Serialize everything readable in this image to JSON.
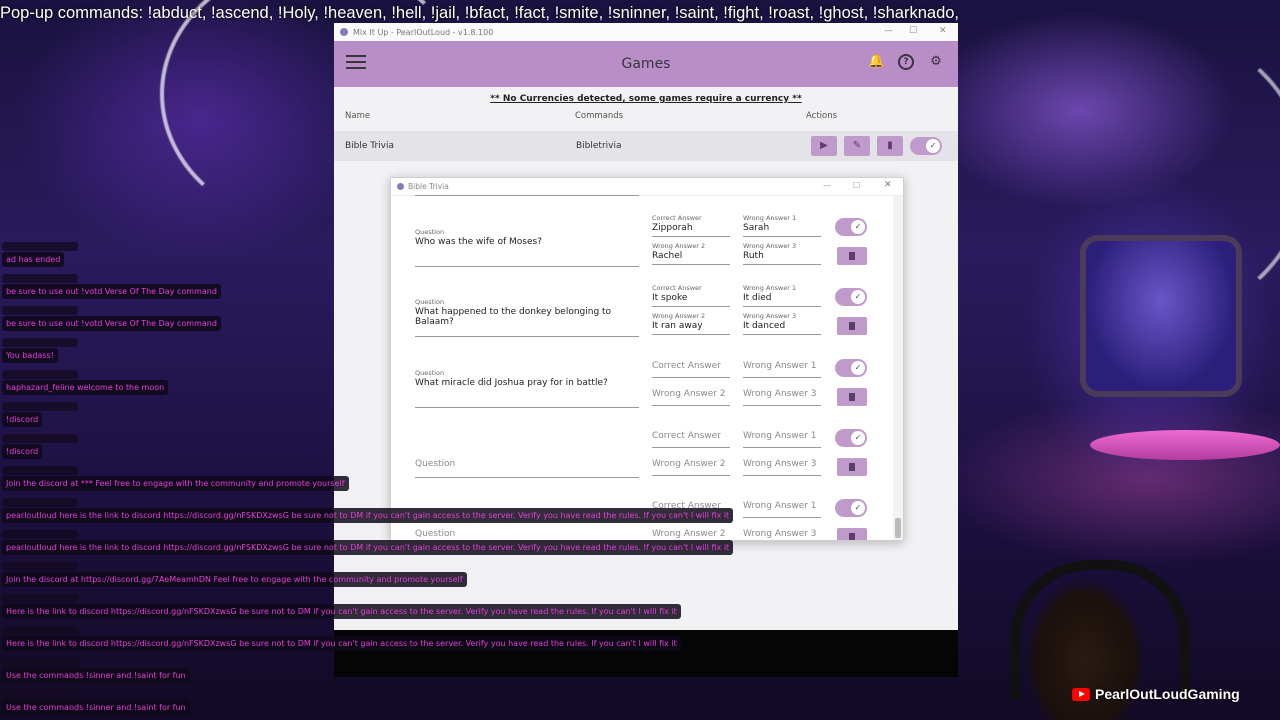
{
  "overlay": {
    "popup_commands": "Pop-up commands: !abduct, !ascend, !Holy, !heaven, !hell,  !jail, !bfact, !fact, !smite, !sninner, !saint, !fight, !roast, !ghost, !sharknado,",
    "channel_name": "PearlOutLoudGaming"
  },
  "app": {
    "window_title": "Mix It Up - PearlOutLoud - v1.8.100",
    "header_title": "Games",
    "notice": "** No Currencies detected, some games require a currency **",
    "columns": {
      "name": "Name",
      "commands": "Commands",
      "actions": "Actions"
    },
    "game_row": {
      "name": "Bible Trivia",
      "command": "Bibletrivia",
      "enabled": true
    }
  },
  "dialog": {
    "title": "Bible Trivia",
    "labels": {
      "question": "Question",
      "correct": "Correct Answer",
      "wrong1": "Wrong Answer 1",
      "wrong2": "Wrong Answer 2",
      "wrong3": "Wrong Answer 3"
    },
    "questions": [
      {
        "question": "Who was the wife of Moses?",
        "correct": "Zipporah",
        "wrong1": "Sarah",
        "wrong2": "Rachel",
        "wrong3": "Ruth",
        "enabled": true
      },
      {
        "question": "What happened to the donkey belonging to Balaam?",
        "correct": "It spoke",
        "wrong1": "It died",
        "wrong2": "It ran away",
        "wrong3": "It danced",
        "enabled": true
      },
      {
        "question": "What miracle did Joshua pray for in battle?",
        "correct": "",
        "wrong1": "",
        "wrong2": "",
        "wrong3": "",
        "enabled": true
      },
      {
        "question": "",
        "correct": "",
        "wrong1": "",
        "wrong2": "",
        "wrong3": "",
        "enabled": true
      },
      {
        "question": "",
        "correct": "",
        "wrong1": "",
        "wrong2": "",
        "wrong3": "",
        "enabled": true
      }
    ]
  },
  "chat": {
    "messages": [
      "ad has ended",
      "be sure to use out !votd Verse Of The Day command",
      "be sure to use out !votd Verse Of The Day command",
      "You badass!",
      "haphazard_feline welcome to the moon",
      "!discord",
      "!discord",
      "Join the discord at *** Feel free to engage with the community and promote yourself",
      "pearloutloud here is the link to discord https://discord.gg/nFSKDXzwsG be sure not to DM if you can't gain access to the server. Verify you have read the rules. If you can't I will fix it",
      "pearloutloud here is the link to discord https://discord.gg/nFSKDXzwsG be sure not to DM if you can't gain access to the server. Verify you have read the rules. If you can't I will fix it",
      "Join the discord at https://discord.gg/7AeMeamhDN Feel free to engage with the community and promote yourself",
      "Here is the link to discord https://discord.gg/nFSKDXzwsG be sure not to DM if you can't gain access to the server. Verify you have read the rules. If you can't I will fix it",
      "Here is the link to discord https://discord.gg/nFSKDXzwsG be sure not to DM if you can't gain access to the server. Verify you have read the rules. If you can't I will fix it",
      "Use the commands !sinner and !saint for fun",
      "Use the commands !sinner and !saint for fun"
    ]
  }
}
